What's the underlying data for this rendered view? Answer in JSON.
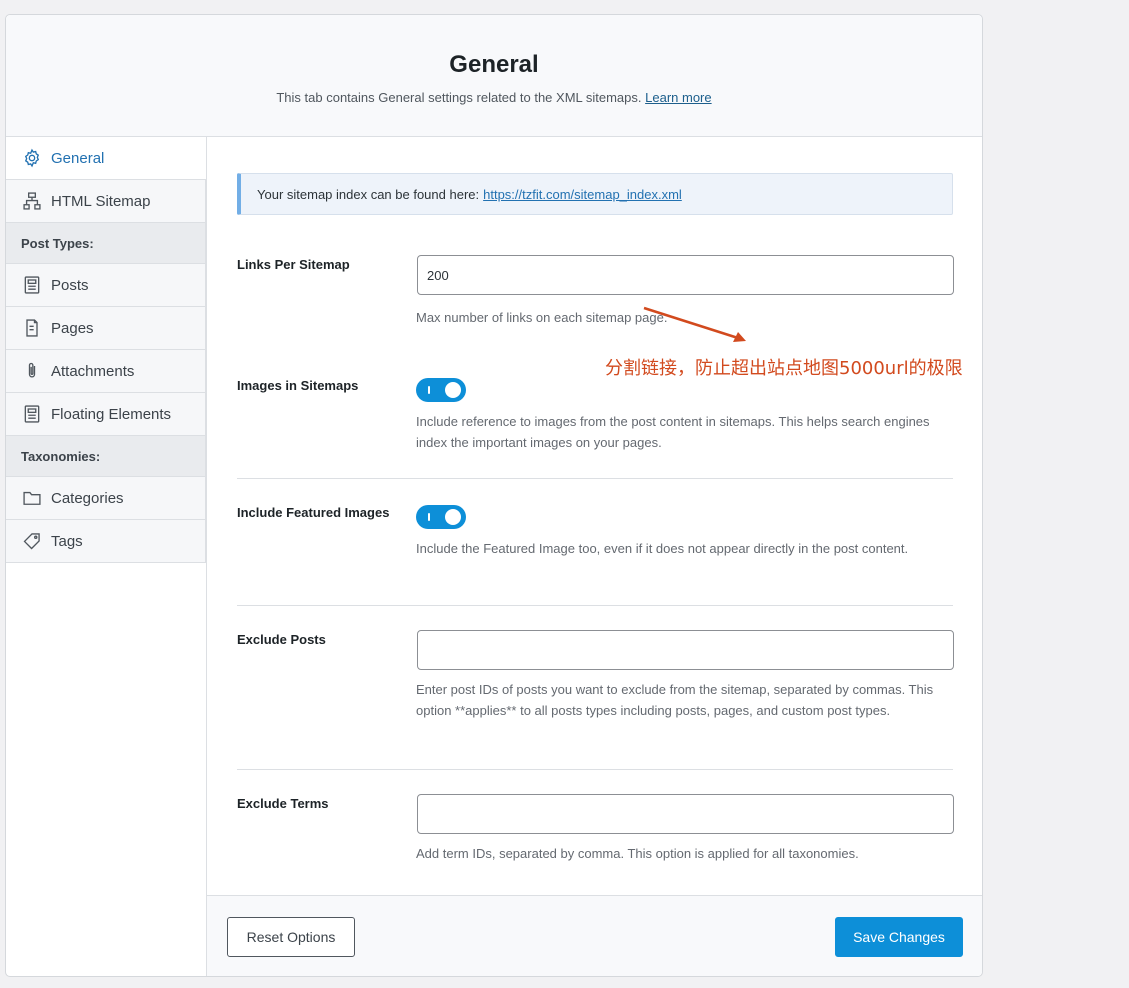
{
  "header": {
    "title": "General",
    "subtitle": "This tab contains General settings related to the XML sitemaps.",
    "learn_more": "Learn more"
  },
  "sidebar": {
    "items": [
      {
        "label": "General",
        "icon": "gear-icon",
        "active": true
      },
      {
        "label": "HTML Sitemap",
        "icon": "sitemap-icon"
      }
    ],
    "group_post_types": "Post Types:",
    "post_types": [
      {
        "label": "Posts",
        "icon": "document-icon"
      },
      {
        "label": "Pages",
        "icon": "page-icon"
      },
      {
        "label": "Attachments",
        "icon": "paperclip-icon"
      },
      {
        "label": "Floating Elements",
        "icon": "document-icon"
      }
    ],
    "group_taxonomies": "Taxonomies:",
    "taxonomies": [
      {
        "label": "Categories",
        "icon": "folder-icon"
      },
      {
        "label": "Tags",
        "icon": "tag-icon"
      }
    ]
  },
  "notice": {
    "text": "Your sitemap index can be found here:",
    "link": "https://tzfit.com/sitemap_index.xml"
  },
  "fields": {
    "links_per_sitemap": {
      "label": "Links Per Sitemap",
      "value": "200",
      "desc": "Max number of links on each sitemap page."
    },
    "images_in_sitemaps": {
      "label": "Images in Sitemaps",
      "enabled": true,
      "desc": "Include reference to images from the post content in sitemaps. This helps search engines index the important images on your pages."
    },
    "include_featured_images": {
      "label": "Include Featured Images",
      "enabled": true,
      "desc": "Include the Featured Image too, even if it does not appear directly in the post content."
    },
    "exclude_posts": {
      "label": "Exclude Posts",
      "value": "",
      "desc": "Enter post IDs of posts you want to exclude from the sitemap, separated by commas. This option **applies** to all posts types including posts, pages, and custom post types."
    },
    "exclude_terms": {
      "label": "Exclude Terms",
      "value": "",
      "desc": "Add term IDs, separated by comma. This option is applied for all taxonomies."
    }
  },
  "footer": {
    "reset_label": "Reset Options",
    "save_label": "Save Changes"
  },
  "annotation": {
    "text": "分割链接，防止超出站点地图5000url的极限"
  },
  "colors": {
    "accent": "#0d8fd8",
    "link": "#2271b1",
    "annotation": "#d24a1e"
  }
}
